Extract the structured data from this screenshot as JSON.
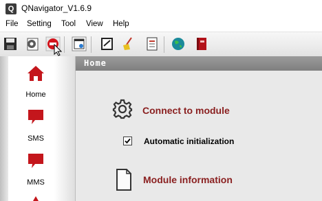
{
  "window": {
    "title": "QNavigator_V1.6.9",
    "app_icon_letter": "Q"
  },
  "menu": [
    "File",
    "Setting",
    "Tool",
    "View",
    "Help"
  ],
  "toolbar": {
    "icons": [
      "save-icon",
      "settings-icon",
      "disconnect-icon",
      "new-window-icon",
      "edit-icon",
      "clean-icon",
      "document-icon",
      "globe-icon",
      "book-icon"
    ]
  },
  "sidebar": {
    "items": [
      {
        "label": "Home",
        "icon": "home-icon"
      },
      {
        "label": "SMS",
        "icon": "sms-icon"
      },
      {
        "label": "MMS",
        "icon": "mms-icon"
      }
    ]
  },
  "header": {
    "title": "Home"
  },
  "main": {
    "connect": {
      "title": "Connect to module",
      "icon": "gear-icon"
    },
    "auto_init": {
      "label": "Automatic initialization",
      "checked": true
    },
    "module_info": {
      "title": "Module information",
      "icon": "document-icon"
    }
  },
  "colors": {
    "accent": "#8a2020",
    "header_bg": "#8a8a8a",
    "icon_red": "#c4161c"
  }
}
